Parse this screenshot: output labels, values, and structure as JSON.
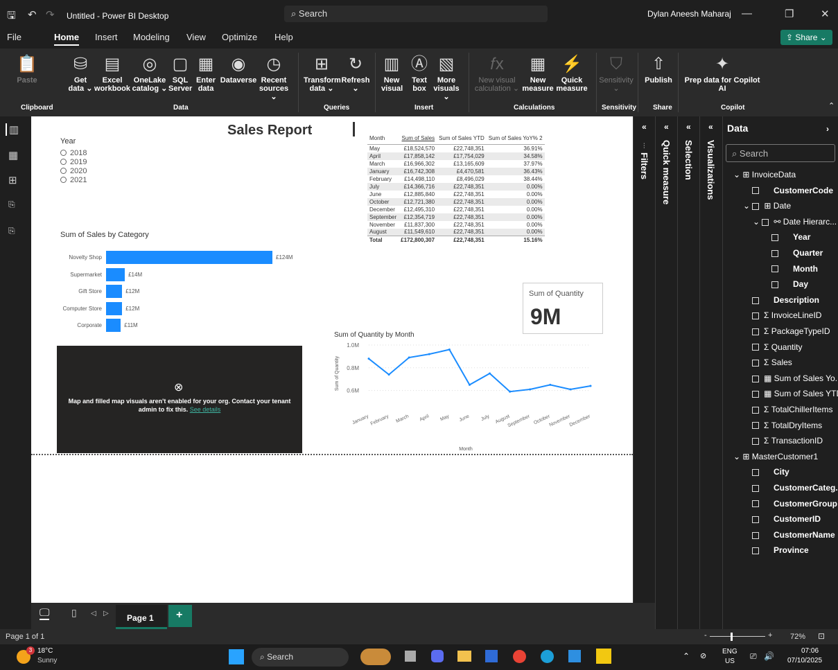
{
  "titlebar": {
    "title": "Untitled - Power BI Desktop",
    "search": "Search",
    "user": "Dylan Aneesh Maharaj"
  },
  "menu": {
    "items": [
      "File",
      "Home",
      "Insert",
      "Modeling",
      "View",
      "Optimize",
      "Help"
    ],
    "share": "Share"
  },
  "ribbon": {
    "buttons": [
      {
        "label": "Paste",
        "disabled": true
      },
      {
        "label": "Get data ⌄"
      },
      {
        "label": "Excel workbook"
      },
      {
        "label": "OneLake catalog ⌄"
      },
      {
        "label": "SQL Server"
      },
      {
        "label": "Enter data"
      },
      {
        "label": "Dataverse"
      },
      {
        "label": "Recent sources ⌄"
      },
      {
        "label": "Transform data ⌄"
      },
      {
        "label": "Refresh ⌄"
      },
      {
        "label": "New visual"
      },
      {
        "label": "Text box"
      },
      {
        "label": "More visuals ⌄"
      },
      {
        "label": "New visual calculation ⌄",
        "disabled": true
      },
      {
        "label": "New measure"
      },
      {
        "label": "Quick measure"
      },
      {
        "label": "Sensitivity ⌄",
        "disabled": true
      },
      {
        "label": "Publish"
      },
      {
        "label": "Prep data for Copilot AI"
      }
    ],
    "groups": [
      "Clipboard",
      "Data",
      "Queries",
      "Insert",
      "Calculations",
      "Sensitivity",
      "Share",
      "Copilot"
    ]
  },
  "panes": {
    "filters": "Filters",
    "quick_measure": "Quick measure",
    "selection": "Selection",
    "visualizations": "Visualizations"
  },
  "data_pane": {
    "title": "Data",
    "search_placeholder": "Search",
    "fields": [
      {
        "label": "InvoiceData",
        "kind": "table",
        "level": 0
      },
      {
        "label": "CustomerCode",
        "kind": "field",
        "level": 1
      },
      {
        "label": "Date",
        "kind": "table",
        "level": 1
      },
      {
        "label": "Date Hierarc...",
        "kind": "hierarchy",
        "level": 2
      },
      {
        "label": "Year",
        "kind": "field",
        "level": 3
      },
      {
        "label": "Quarter",
        "kind": "field",
        "level": 3
      },
      {
        "label": "Month",
        "kind": "field",
        "level": 3
      },
      {
        "label": "Day",
        "kind": "field",
        "level": 3
      },
      {
        "label": "Description",
        "kind": "field",
        "level": 1
      },
      {
        "label": "InvoiceLineID",
        "kind": "sum",
        "level": 1
      },
      {
        "label": "PackageTypeID",
        "kind": "sum",
        "level": 1
      },
      {
        "label": "Quantity",
        "kind": "sum",
        "level": 1
      },
      {
        "label": "Sales",
        "kind": "sum",
        "level": 1
      },
      {
        "label": "Sum of Sales Yo...",
        "kind": "measure",
        "level": 1
      },
      {
        "label": "Sum of Sales YTD",
        "kind": "measure",
        "level": 1
      },
      {
        "label": "TotalChillerItems",
        "kind": "sum",
        "level": 1
      },
      {
        "label": "TotalDryItems",
        "kind": "sum",
        "level": 1
      },
      {
        "label": "TransactionID",
        "kind": "sum",
        "level": 1
      },
      {
        "label": "MasterCustomer1",
        "kind": "table",
        "level": 0
      },
      {
        "label": "City",
        "kind": "field",
        "level": 1
      },
      {
        "label": "CustomerCateg...",
        "kind": "field",
        "level": 1
      },
      {
        "label": "CustomerGroup",
        "kind": "field",
        "level": 1
      },
      {
        "label": "CustomerID",
        "kind": "field",
        "level": 1
      },
      {
        "label": "CustomerName",
        "kind": "field",
        "level": 1
      },
      {
        "label": "Province",
        "kind": "field",
        "level": 1
      }
    ]
  },
  "report": {
    "title": "Sales Report",
    "slicer": {
      "title": "Year",
      "options": [
        "2018",
        "2019",
        "2020",
        "2021"
      ]
    },
    "card": {
      "label": "Sum of Quantity",
      "value": "9M"
    },
    "map_error": {
      "message": "Map and filled map visuals aren't enabled for your org. Contact your tenant admin to fix this.",
      "link": "See details"
    },
    "table": {
      "headers": [
        "Month",
        "Sum of Sales",
        "Sum of Sales YTD",
        "Sum of Sales YoY% 2"
      ],
      "rows": [
        [
          "May",
          "£18,524,570",
          "£22,748,351",
          "36.91%"
        ],
        [
          "April",
          "£17,858,142",
          "£17,754,029",
          "34.58%"
        ],
        [
          "March",
          "£16,966,302",
          "£13,165,609",
          "37.97%"
        ],
        [
          "January",
          "£16,742,308",
          "£4,470,581",
          "36.43%"
        ],
        [
          "February",
          "£14,498,110",
          "£8,496,029",
          "38.44%"
        ],
        [
          "July",
          "£14,366,716",
          "£22,748,351",
          "0.00%"
        ],
        [
          "June",
          "£12,885,840",
          "£22,748,351",
          "0.00%"
        ],
        [
          "October",
          "£12,721,380",
          "£22,748,351",
          "0.00%"
        ],
        [
          "December",
          "£12,495,310",
          "£22,748,351",
          "0.00%"
        ],
        [
          "September",
          "£12,354,719",
          "£22,748,351",
          "0.00%"
        ],
        [
          "November",
          "£11,837,300",
          "£22,748,351",
          "0.00%"
        ],
        [
          "August",
          "£11,549,610",
          "£22,748,351",
          "0.00%"
        ]
      ],
      "total": [
        "Total",
        "£172,800,307",
        "£22,748,351",
        "15.16%"
      ]
    }
  },
  "chart_data": [
    {
      "type": "bar",
      "title": "Sum of Sales by Category",
      "categories": [
        "Novelty Shop",
        "Supermarket",
        "Gift Store",
        "Computer Store",
        "Corporate"
      ],
      "values": [
        124,
        14,
        12,
        12,
        11
      ],
      "data_labels": [
        "£124M",
        "£14M",
        "£12M",
        "£12M",
        "£11M"
      ],
      "orientation": "horizontal",
      "color": "#1a8cff"
    },
    {
      "type": "line",
      "title": "Sum of Quantity by Month",
      "xlabel": "Month",
      "ylabel": "Sum of Quantity",
      "categories": [
        "January",
        "February",
        "March",
        "April",
        "May",
        "June",
        "July",
        "August",
        "September",
        "October",
        "November",
        "December"
      ],
      "values": [
        0.88,
        0.74,
        0.89,
        0.92,
        0.96,
        0.65,
        0.75,
        0.59,
        0.61,
        0.65,
        0.61,
        0.64
      ],
      "yticks": [
        "0.6M",
        "0.8M",
        "1.0M"
      ],
      "ylim": [
        0.5,
        1.0
      ],
      "color": "#1a8cff"
    }
  ],
  "page_tabs": {
    "page": "Page 1",
    "add": "+"
  },
  "status": {
    "page": "Page 1 of 1",
    "zoom": "72%"
  },
  "taskbar": {
    "weather_temp": "18°C",
    "weather_desc": "Sunny",
    "badge": "3",
    "search": "Search",
    "lang": "ENG",
    "region": "US",
    "time": "07:06",
    "date": "07/10/2025"
  }
}
